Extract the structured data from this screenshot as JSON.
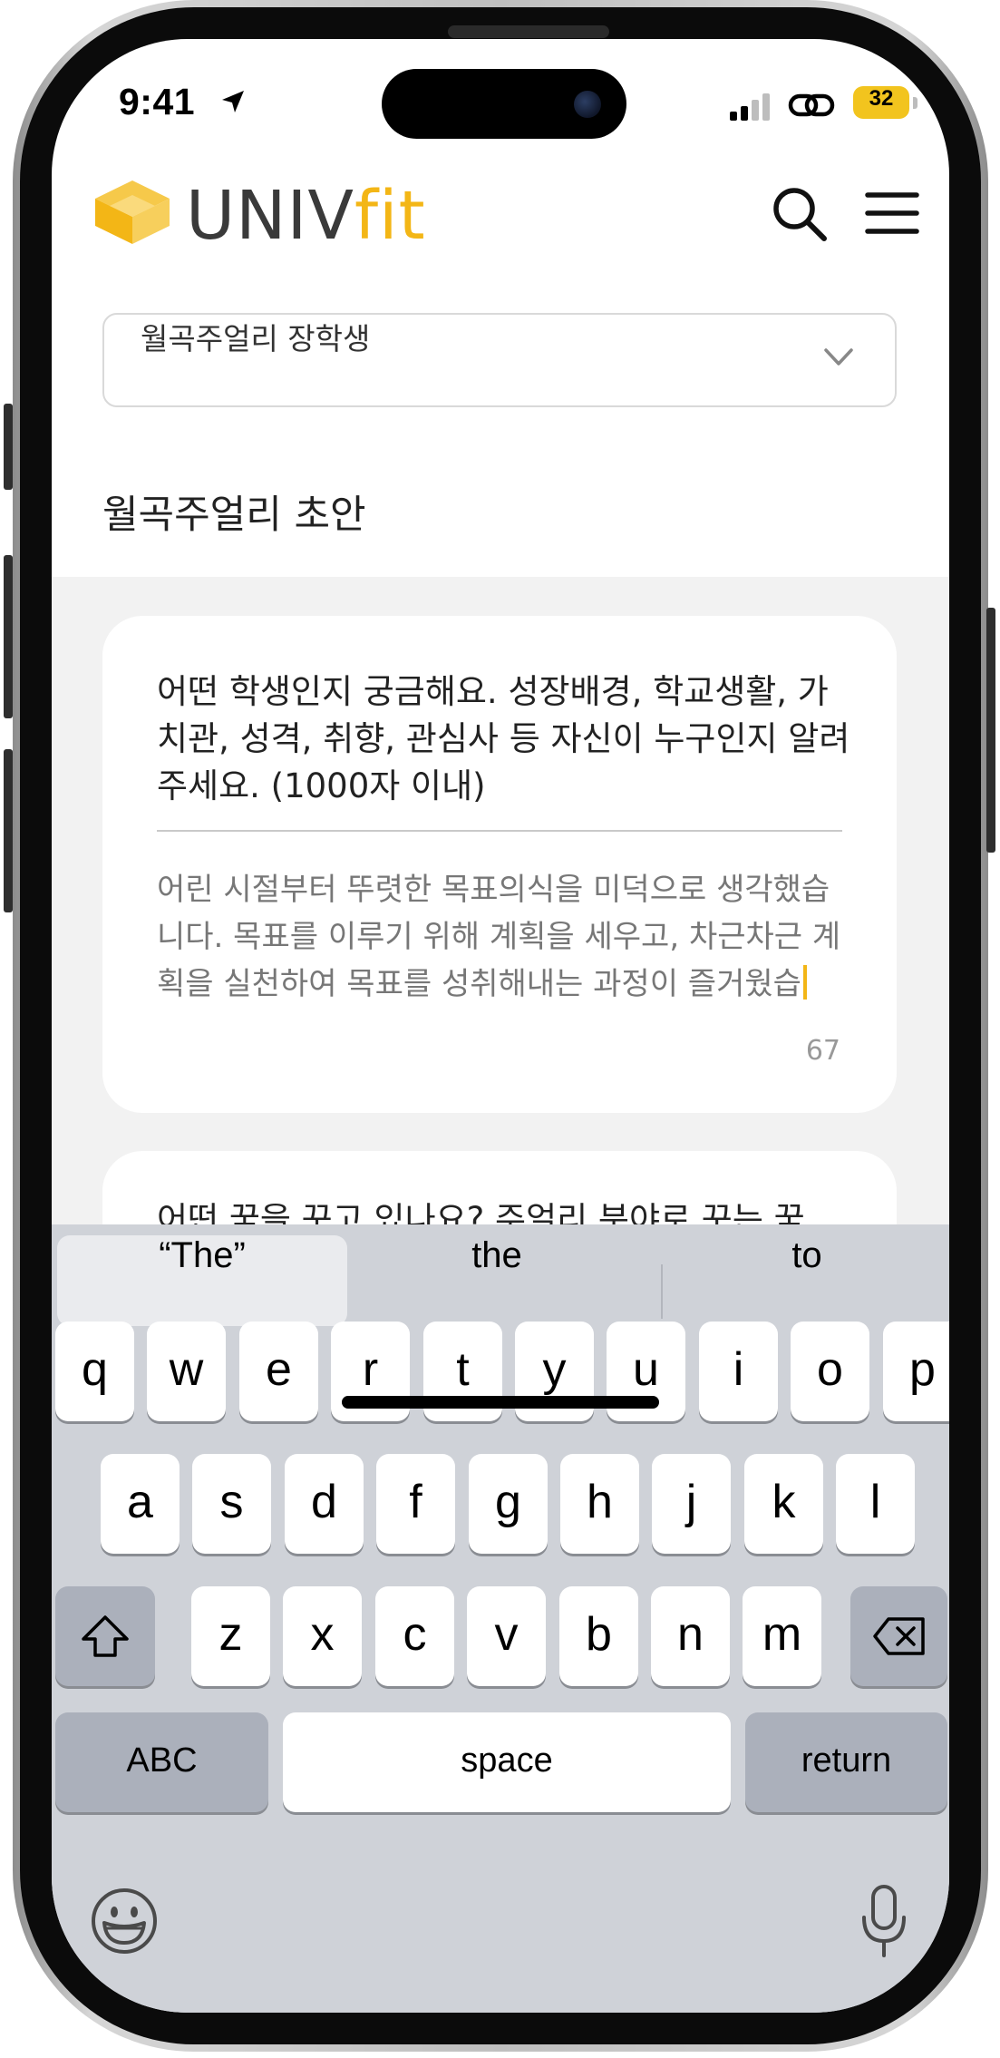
{
  "status_bar": {
    "time": "9:41",
    "battery": "32"
  },
  "header": {
    "logo_part1": "UNIV",
    "logo_part2": "fit"
  },
  "select": {
    "value": "월곡주얼리 장학생"
  },
  "section_title": "월곡주얼리 초안",
  "cards": [
    {
      "question": "어떤 학생인지 궁금해요. 성장배경, 학교생활, 가치관, 성격, 취향, 관심사 등 자신이 누구인지 알려주세요. (1000자 이내)",
      "answer": "어린 시절부터 뚜렷한 목표의식을 미덕으로 생각했습니다. 목표를 이루기 위해 계획을 세우고, 차근차근 계획을 실천하여 목표를 성취해내는 과정이 즐거웠습",
      "char_count": "67"
    },
    {
      "question": "어떤 꿈을 꾸고 있나요? 주얼리 분야로 꾸는 꿈"
    }
  ],
  "keyboard": {
    "suggestions": [
      "“The”",
      "the",
      "to"
    ],
    "row1": [
      "q",
      "w",
      "e",
      "r",
      "t",
      "y",
      "u",
      "i",
      "o",
      "p"
    ],
    "row2": [
      "a",
      "s",
      "d",
      "f",
      "g",
      "h",
      "j",
      "k",
      "l"
    ],
    "row3": [
      "z",
      "x",
      "c",
      "v",
      "b",
      "n",
      "m"
    ],
    "abc_label": "ABC",
    "space_label": "space",
    "return_label": "return"
  }
}
